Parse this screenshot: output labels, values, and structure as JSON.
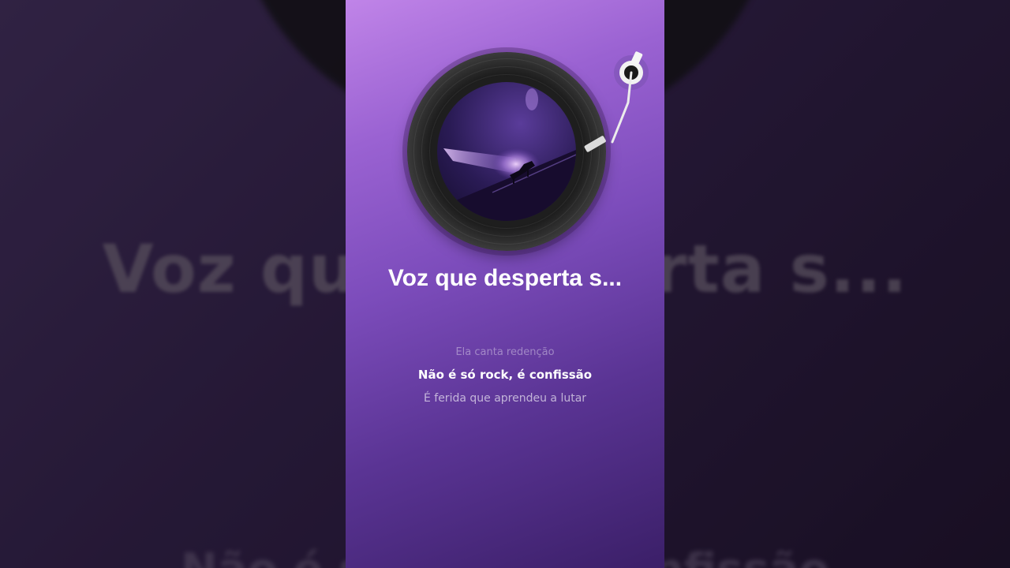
{
  "song": {
    "title": "Voz que desperta s...",
    "background_title": "Voz que desperta s...",
    "background_lyric": "Não é só rock, é confissão"
  },
  "lyrics": {
    "previous": "Ela canta redenção",
    "current": "Não é só rock, é confissão",
    "next": "É ferida que aprendeu a lutar"
  },
  "colors": {
    "accent": "#9a62d2",
    "background": "#241733",
    "text": "#ffffff"
  },
  "icons": {
    "record": "vinyl-record-icon",
    "tonearm": "tonearm-icon",
    "cover": "piano-stage-cover"
  }
}
